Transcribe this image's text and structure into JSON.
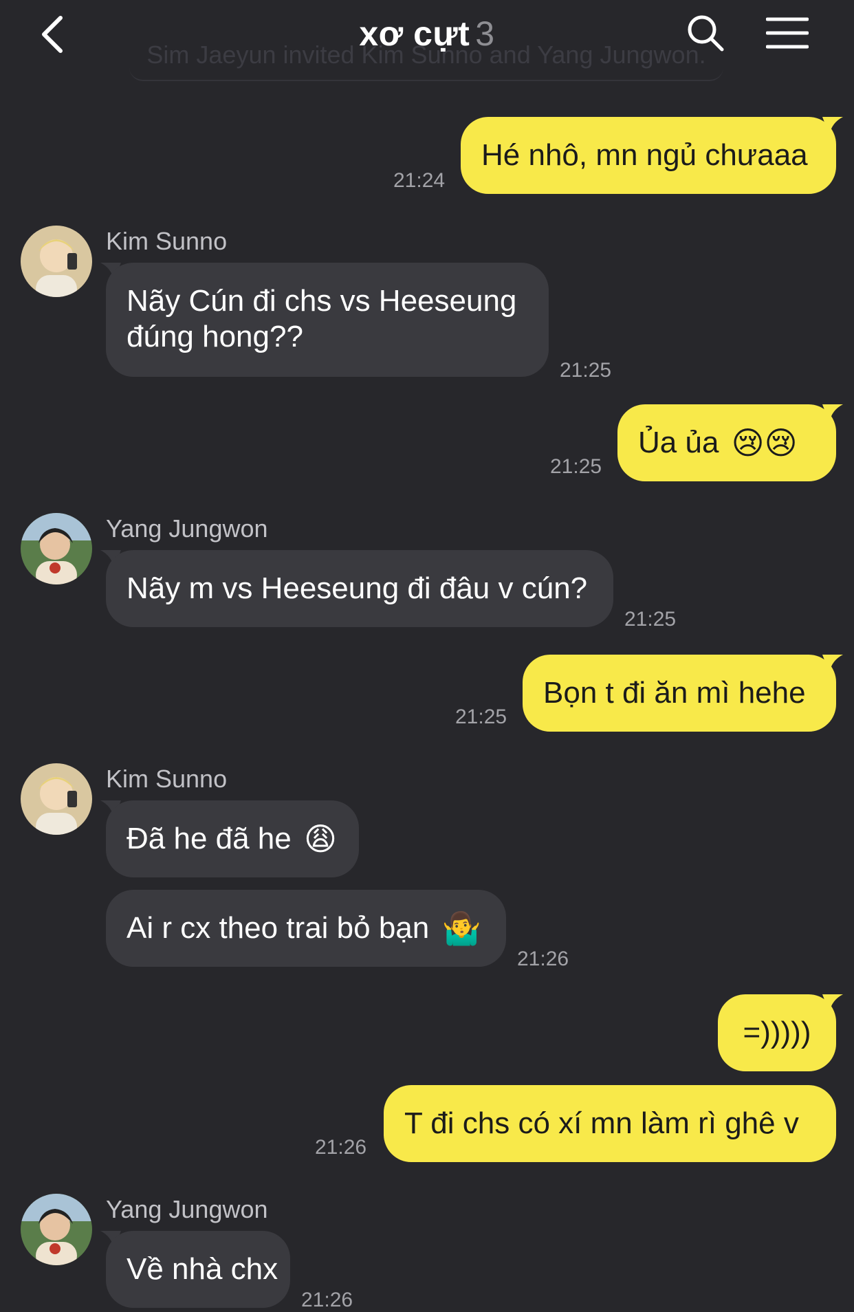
{
  "header": {
    "title": "xơ cựt",
    "member_count": "3",
    "system_message": "Sim Jaeyun invited Kim Sunno and Yang Jungwon."
  },
  "colors": {
    "background": "#27272b",
    "my_bubble": "#f8e94a",
    "their_bubble": "#3a3a3f"
  },
  "messages": [
    {
      "side": "me",
      "text": "Hé nhô, mn ngủ chưaaa",
      "time": "21:24"
    },
    {
      "side": "them",
      "sender": "Kim Sunno",
      "text": "Nãy Cún đi chs vs Heeseung đúng hong??",
      "time": "21:25"
    },
    {
      "side": "me",
      "text": "Ủa ủa",
      "emoji": "😢😢",
      "time": "21:25"
    },
    {
      "side": "them",
      "sender": "Yang Jungwon",
      "text": "Nãy m vs Heeseung đi đâu v cún?",
      "time": "21:25"
    },
    {
      "side": "me",
      "text": "Bọn t đi ăn mì hehe",
      "time": "21:25"
    },
    {
      "side": "them",
      "sender": "Kim Sunno",
      "text": "Đã he đã he",
      "emoji": "😩"
    },
    {
      "side": "them",
      "text": "Ai r cx theo trai bỏ bạn",
      "emoji": "🤷‍♂️",
      "time": "21:26"
    },
    {
      "side": "me",
      "text": "=)))))"
    },
    {
      "side": "me",
      "text": "T đi chs có xí mn làm rì ghê v",
      "time": "21:26"
    },
    {
      "side": "them",
      "sender": "Yang Jungwon",
      "text": "Về nhà chx",
      "time": "21:26"
    }
  ],
  "icons": {
    "back": "chevron-left-icon",
    "search": "search-icon",
    "menu": "menu-icon"
  }
}
